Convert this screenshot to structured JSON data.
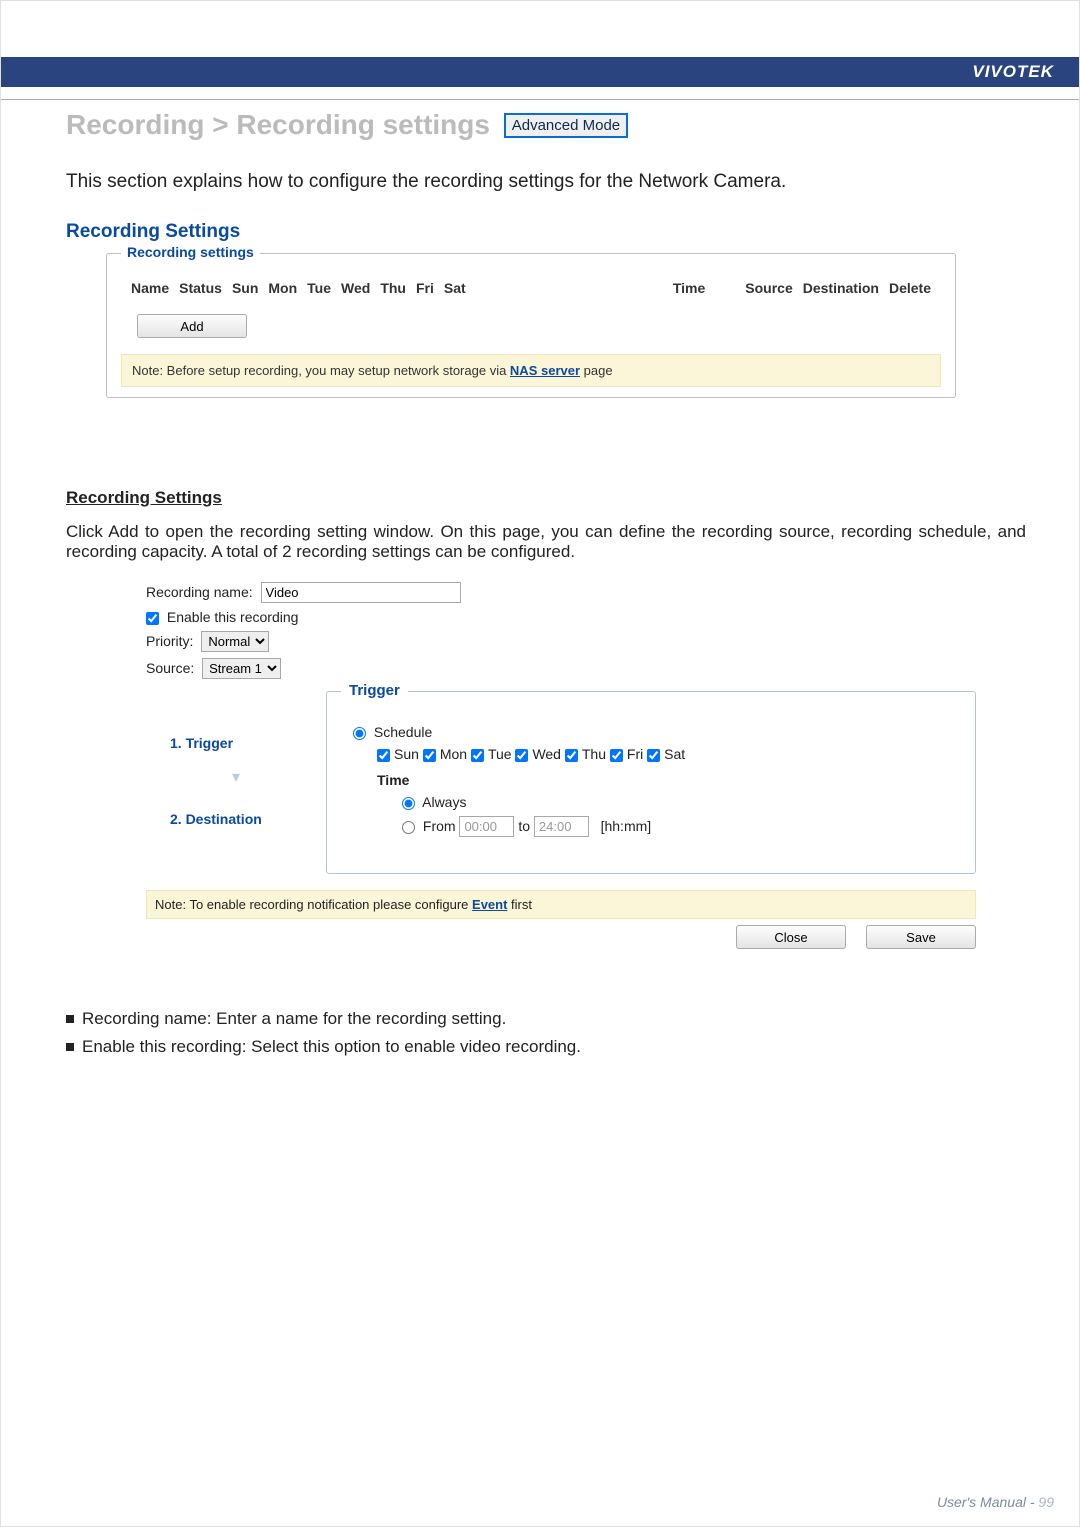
{
  "brand": "VIVOTEK",
  "page_title_prefix": "Recording > Recording settings",
  "mode_badge": "Advanced Mode",
  "intro_text": "This section explains how to configure the recording settings for the Network Camera.",
  "subheading": "Recording Settings",
  "panel": {
    "legend": "Recording settings",
    "headers": [
      "Name",
      "Status",
      "Sun",
      "Mon",
      "Tue",
      "Wed",
      "Thu",
      "Fri",
      "Sat",
      "Time",
      "Source",
      "Destination",
      "Delete"
    ],
    "add_label": "Add",
    "note_prefix": "Note: Before setup recording, you may setup network storage via ",
    "note_link": "NAS server",
    "note_suffix": " page"
  },
  "section_title": "Recording Settings",
  "section_paragraph": "Click Add to open the recording setting window. On this page, you can define the recording source, recording schedule, and recording capacity. A total of 2 recording settings can be configured.",
  "form": {
    "recording_name_label": "Recording name:",
    "recording_name_value": "Video",
    "enable_label": "Enable this recording",
    "priority_label": "Priority:",
    "priority_value": "Normal",
    "source_label": "Source:",
    "source_value": "Stream 1",
    "steps": {
      "s1": "1. Trigger",
      "s2": "2. Destination"
    },
    "trigger_legend": "Trigger",
    "schedule_label": "Schedule",
    "days": [
      "Sun",
      "Mon",
      "Tue",
      "Wed",
      "Thu",
      "Fri",
      "Sat"
    ],
    "time_label": "Time",
    "always_label": "Always",
    "from_label": "From",
    "from_value": "00:00",
    "to_label": "to",
    "to_value": "24:00",
    "hhmm": "[hh:mm]"
  },
  "note2_prefix": "Note: To enable recording notification please configure ",
  "note2_link": "Event",
  "note2_suffix": " first",
  "buttons": {
    "close": "Close",
    "save": "Save"
  },
  "bullets": {
    "b1": "Recording name: Enter a name for the recording setting.",
    "b2": "Enable this recording: Select this option to enable video recording."
  },
  "footer_text": "User's Manual - ",
  "footer_page": "99"
}
